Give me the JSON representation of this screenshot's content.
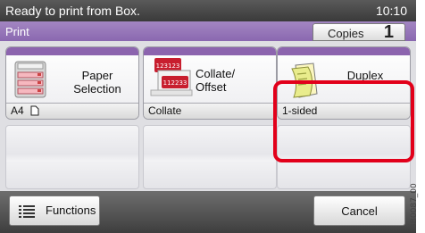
{
  "status": {
    "message": "Ready to print from Box.",
    "time": "10:10"
  },
  "header": {
    "title": "Print",
    "copies_label": "Copies",
    "copies_value": "1"
  },
  "functions": [
    {
      "label_line1": "Paper",
      "label_line2": "Selection",
      "value": "A4",
      "icon": "paper-tray-icon"
    },
    {
      "label_line1": "Collate/",
      "label_line2": "Offset",
      "value": "Collate",
      "icon": "collate-icon",
      "icon_text_1": "123123",
      "icon_text_2": "112233"
    },
    {
      "label_line1": "Duplex",
      "label_line2": "",
      "value": "1-sided",
      "icon": "duplex-page-icon"
    }
  ],
  "bottom": {
    "functions_label": "Functions",
    "cancel_label": "Cancel"
  },
  "figure_code": "3B0087_00",
  "colors": {
    "accent": "#8c64ae",
    "highlight": "#e2001a",
    "status_bar": "#3a3a3a"
  }
}
